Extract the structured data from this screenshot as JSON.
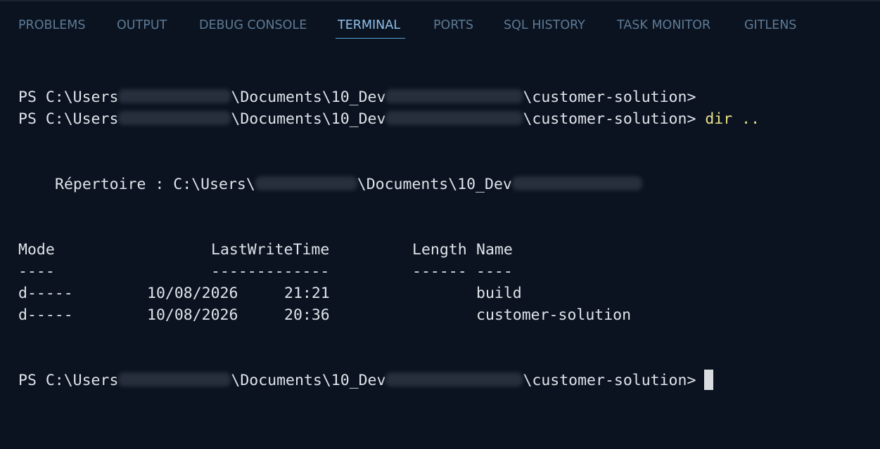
{
  "panel": {
    "tabs": [
      {
        "label": "PROBLEMS"
      },
      {
        "label": "OUTPUT"
      },
      {
        "label": "DEBUG CONSOLE"
      },
      {
        "label": "TERMINAL"
      },
      {
        "label": "PORTS"
      },
      {
        "label": "SQL HISTORY"
      },
      {
        "label": "TASK MONITOR"
      },
      {
        "label": "GITLENS"
      }
    ],
    "active_tab": "TERMINAL"
  },
  "terminal": {
    "prompt_prefix": "PS C:\\Users",
    "prompt_middle": "\\Documents\\10_Dev",
    "prompt_suffix": "\\customer-solution>",
    "command": "dir ..",
    "directory_label": "Répertoire : C:\\Users\\",
    "directory_middle": "\\Documents\\10_Dev",
    "table": {
      "headers": {
        "mode": "Mode",
        "last_write_time": "LastWriteTime",
        "length": "Length",
        "name": "Name"
      },
      "separators": {
        "mode": "----",
        "last_write_time": "-------------",
        "length": "------",
        "name": "----"
      },
      "rows": [
        {
          "mode": "d-----",
          "date": "10/08/2026",
          "time": "21:21",
          "name": "build"
        },
        {
          "mode": "d-----",
          "date": "10/08/2026",
          "time": "20:36",
          "name": "customer-solution"
        }
      ]
    }
  },
  "colors": {
    "background": "#0b1320",
    "tab_inactive": "#5d7a96",
    "tab_active": "#8fc1ec",
    "text": "#dfe4ea",
    "command": "#e8e18a"
  }
}
